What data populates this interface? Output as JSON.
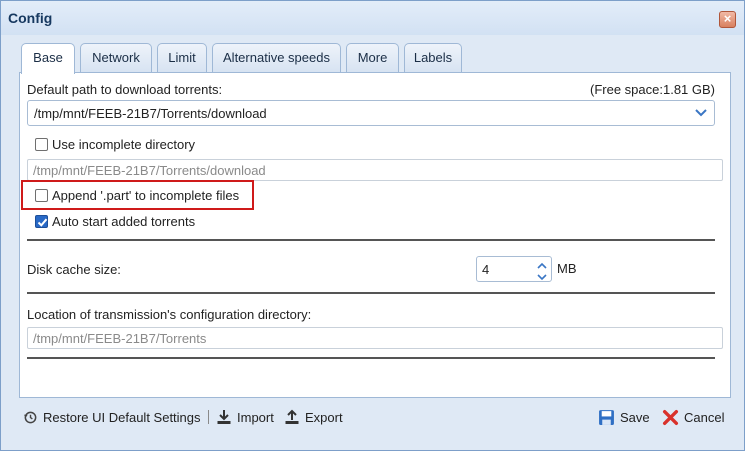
{
  "window": {
    "title": "Config"
  },
  "tabs": [
    {
      "label": "Base",
      "active": true
    },
    {
      "label": "Network"
    },
    {
      "label": "Limit"
    },
    {
      "label": "Alternative speeds"
    },
    {
      "label": "More"
    },
    {
      "label": "Labels"
    }
  ],
  "base": {
    "download_path_label": "Default path to download torrents:",
    "free_space": "(Free space:1.81 GB)",
    "download_path_value": "/tmp/mnt/FEEB-21B7/Torrents/download",
    "use_incomplete_label": "Use incomplete directory",
    "use_incomplete_checked": false,
    "incomplete_path_value": "/tmp/mnt/FEEB-21B7/Torrents/download",
    "append_part_label": "Append '.part' to incomplete files",
    "append_part_checked": false,
    "auto_start_label": "Auto start added torrents",
    "auto_start_checked": true,
    "disk_cache_label": "Disk cache size:",
    "disk_cache_value": "4",
    "disk_cache_unit": "MB",
    "config_dir_label": "Location of transmission's configuration directory:",
    "config_dir_value": "/tmp/mnt/FEEB-21B7/Torrents"
  },
  "footer": {
    "restore_label": "Restore UI Default Settings",
    "import_label": "Import",
    "export_label": "Export",
    "save_label": "Save",
    "cancel_label": "Cancel"
  },
  "icons": {
    "close": "close-icon",
    "dropdown": "chevron-down-icon",
    "restore": "restore-icon",
    "import": "import-icon",
    "export": "export-icon",
    "save": "save-icon",
    "cancel": "cancel-icon"
  },
  "colors": {
    "highlight_border": "#cf1a1a",
    "checkbox_checked": "#2869c6",
    "dialog_background": "#dfe9f5",
    "cancel_icon": "#d9322c"
  }
}
